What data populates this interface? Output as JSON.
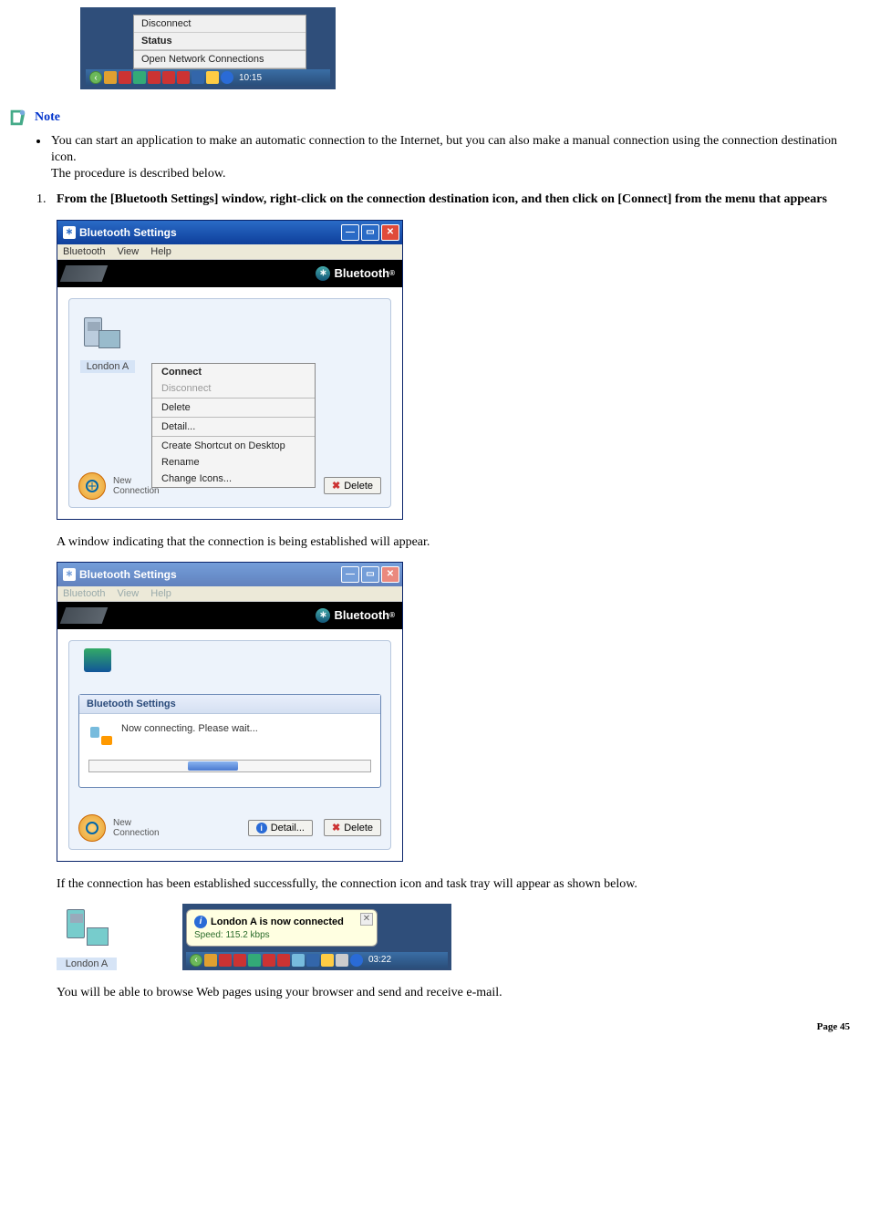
{
  "taskbar_menu": {
    "disconnect": "Disconnect",
    "status": "Status",
    "open_conn": "Open Network Connections",
    "time": "10:15"
  },
  "note_label": "Note",
  "bullet1_line1": "You can start an application to make an automatic connection to the Internet, but you can also make a manual connection using the connection destination icon.",
  "bullet1_line2": "The procedure is described below.",
  "step1_num": "1.",
  "step1_text": "From the [Bluetooth Settings] window, right-click on the connection destination icon, and then click on [Connect] from the menu that appears",
  "bt_window1": {
    "title": "Bluetooth Settings",
    "menu_bt": "Bluetooth",
    "menu_view": "View",
    "menu_help": "Help",
    "logo": "Bluetooth",
    "device": "London A",
    "ctx_connect": "Connect",
    "ctx_disconnect": "Disconnect",
    "ctx_delete": "Delete",
    "ctx_detail": "Detail...",
    "ctx_shortcut": "Create Shortcut on Desktop",
    "ctx_rename": "Rename",
    "ctx_icons": "Change Icons...",
    "footer_new": "New",
    "footer_conn": "Connection",
    "btn_delete": "Delete"
  },
  "text_after1": "A window indicating that the connection is being established will appear.",
  "bt_window2": {
    "title": "Bluetooth Settings",
    "menu_bt": "Bluetooth",
    "menu_view": "View",
    "menu_help": "Help",
    "logo": "Bluetooth",
    "modal_title": "Bluetooth Settings",
    "modal_msg": "Now connecting. Please wait...",
    "footer_new": "New",
    "footer_conn": "Connection",
    "btn_detail": "Detail...",
    "btn_delete": "Delete"
  },
  "text_after2": "If the connection has been established successfully, the connection icon and task tray will appear as shown below.",
  "notif": {
    "device": "London A",
    "title": "London A is now connected",
    "speed": "Speed: 115.2 kbps",
    "time": "03:22"
  },
  "text_after3": "You will be able to browse Web pages using your browser and send and receive e-mail.",
  "page": "Page 45"
}
